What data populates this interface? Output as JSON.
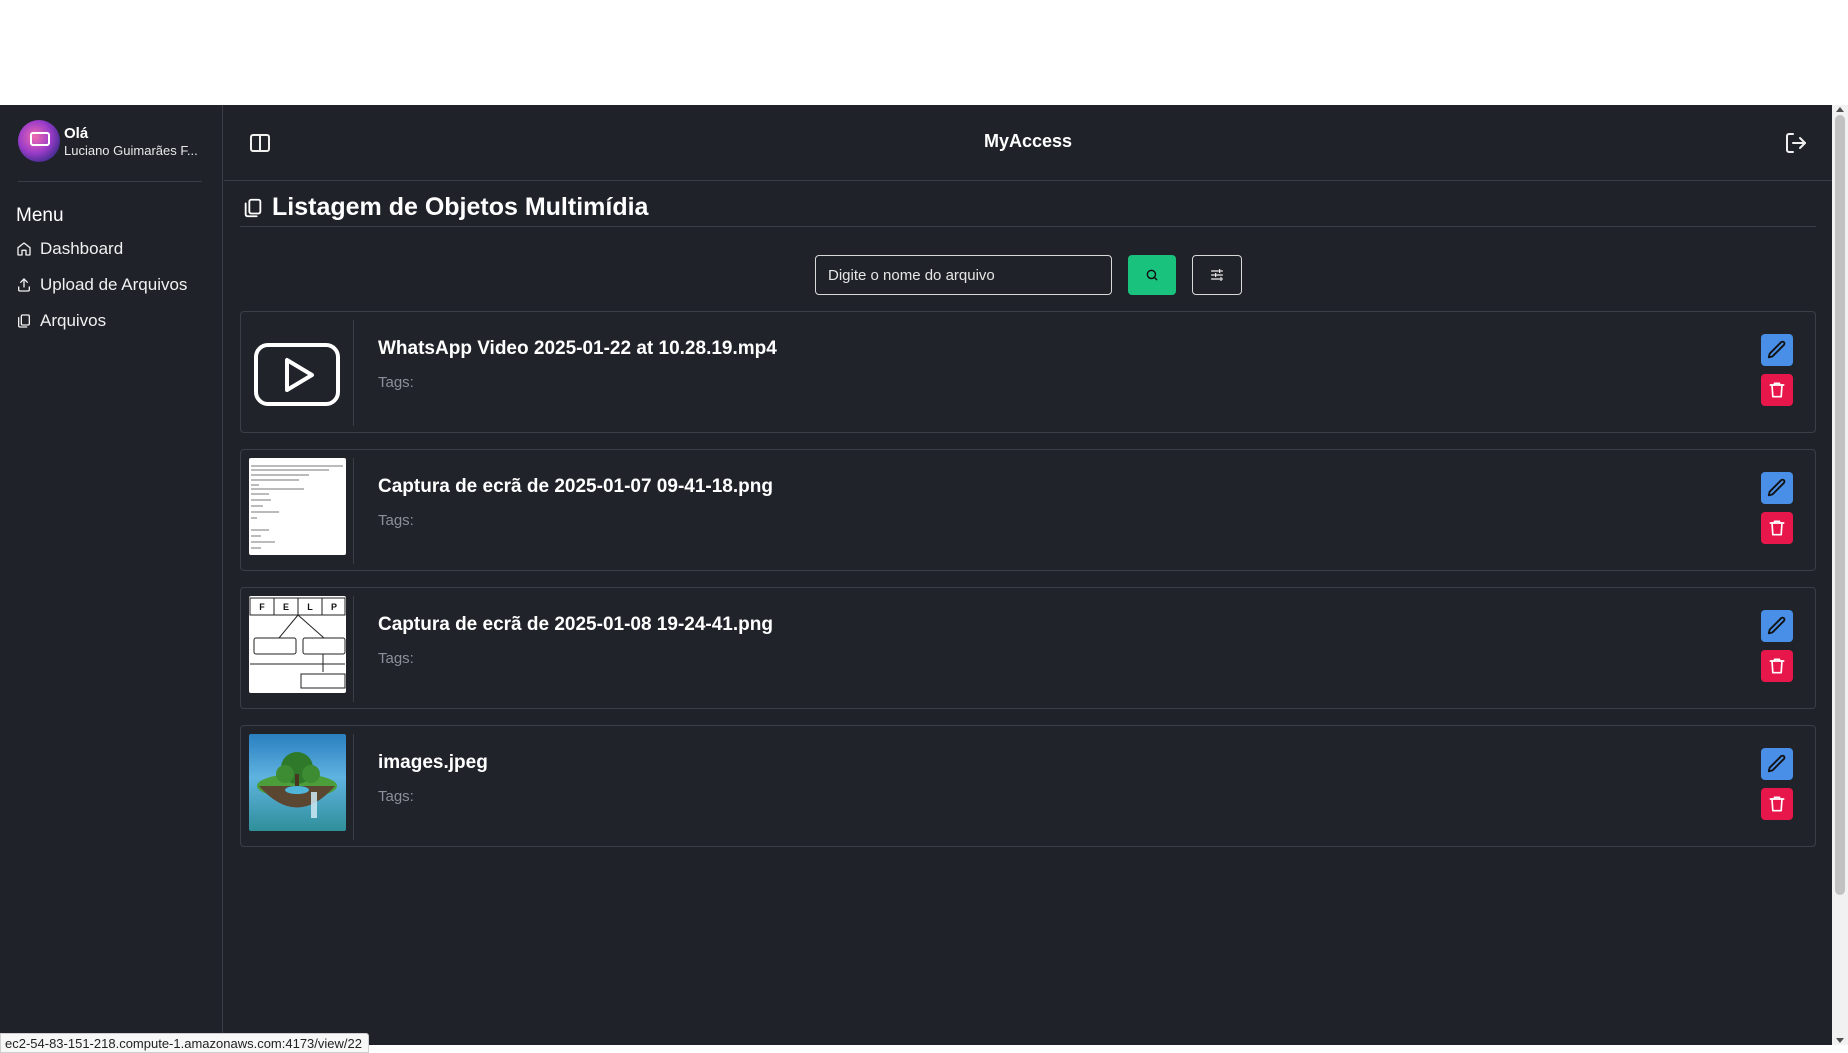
{
  "app": {
    "title": "MyAccess"
  },
  "user": {
    "greeting": "Olá",
    "name": "Luciano Guimarães F..."
  },
  "sidebar": {
    "menu_title": "Menu",
    "items": [
      {
        "label": "Dashboard",
        "icon": "home-icon"
      },
      {
        "label": "Upload de Arquivos",
        "icon": "upload-icon"
      },
      {
        "label": "Arquivos",
        "icon": "files-icon"
      }
    ]
  },
  "page": {
    "title": "Listagem de Objetos Multimídia"
  },
  "search": {
    "placeholder": "Digite o nome do arquivo",
    "value": ""
  },
  "files": [
    {
      "name": "WhatsApp Video 2025-01-22 at 10.28.19.mp4",
      "tags_label": "Tags:",
      "thumbnail": "video-play-icon"
    },
    {
      "name": "Captura de ecrã de 2025-01-07 09-41-18.png",
      "tags_label": "Tags:",
      "thumbnail": "document-screenshot"
    },
    {
      "name": "Captura de ecrã de 2025-01-08 19-24-41.png",
      "tags_label": "Tags:",
      "thumbnail": "diagram-screenshot"
    },
    {
      "name": "images.jpeg",
      "tags_label": "Tags:",
      "thumbnail": "floating-island-image"
    }
  ],
  "diagram_thumb_letters": [
    "F",
    "E",
    "L",
    "P"
  ],
  "status_url": "ec2-54-83-151-218.compute-1.amazonaws.com:4173/view/22",
  "colors": {
    "background": "#1f2229",
    "search_button": "#19c37d",
    "edit_button": "#4a8fe7",
    "delete_button": "#e8174b"
  }
}
